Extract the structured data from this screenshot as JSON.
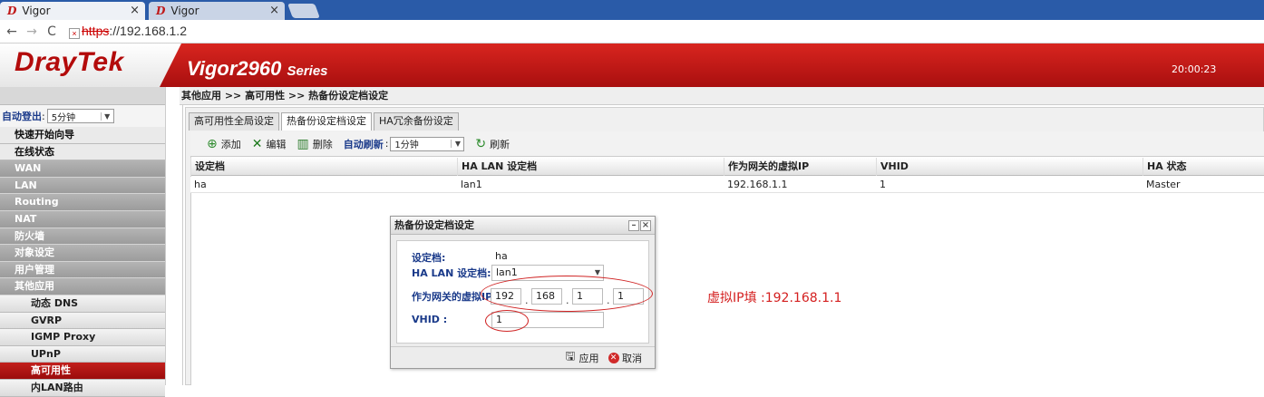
{
  "browser": {
    "tabs": [
      {
        "label": "Vigor"
      },
      {
        "label": "Vigor"
      }
    ],
    "url_proto": "https",
    "url_rest": "://192.168.1.2"
  },
  "banner": {
    "logo": "DrayTek",
    "model": "Vigor2960",
    "model_suffix": "Series",
    "clock": "20:00:23"
  },
  "sidebar": {
    "logout_label": "自动登出",
    "logout_value": "5分钟",
    "items": [
      {
        "label": "快速开始向导",
        "style": "light"
      },
      {
        "label": "在线状态",
        "style": "light"
      },
      {
        "label": "WAN",
        "style": "dark"
      },
      {
        "label": "LAN",
        "style": "dark"
      },
      {
        "label": "Routing",
        "style": "dark"
      },
      {
        "label": "NAT",
        "style": "dark"
      },
      {
        "label": "防火墙",
        "style": "dark"
      },
      {
        "label": "对象设定",
        "style": "dark"
      },
      {
        "label": "用户管理",
        "style": "dark"
      },
      {
        "label": "其他应用",
        "style": "dark"
      },
      {
        "label": "动态 DNS",
        "style": "sub"
      },
      {
        "label": "GVRP",
        "style": "sub"
      },
      {
        "label": "IGMP Proxy",
        "style": "sub"
      },
      {
        "label": "UPnP",
        "style": "sub"
      },
      {
        "label": "高可用性",
        "style": "active"
      },
      {
        "label": "内LAN路由",
        "style": "sub"
      }
    ]
  },
  "breadcrumb": "其他应用 >> 高可用性 >> 热备份设定档设定",
  "content_tabs": [
    {
      "label": "高可用性全局设定",
      "active": false
    },
    {
      "label": "热备份设定档设定",
      "active": true
    },
    {
      "label": "HA冗余备份设定",
      "active": false
    }
  ],
  "toolbar": {
    "add": "添加",
    "edit": "编辑",
    "delete": "删除",
    "auto_refresh_label": "自动刷新",
    "auto_refresh_value": "1分钟",
    "refresh": "刷新"
  },
  "table": {
    "columns": [
      "设定档",
      "HA LAN 设定档",
      "作为网关的虚拟IP",
      "VHID",
      "HA 状态"
    ],
    "rows": [
      [
        "ha",
        "lan1",
        "192.168.1.1",
        "1",
        "Master"
      ]
    ]
  },
  "dialog": {
    "title": "热备份设定档设定",
    "profile_label": "设定档",
    "profile_value": "ha",
    "lan_label": "HA LAN 设定档",
    "lan_value": "lan1",
    "vip_label": "作为网关的虚拟IP",
    "vip_octets": [
      "192",
      "168",
      "1",
      "1"
    ],
    "vhid_label": "VHID",
    "vhid_value": "1",
    "apply": "应用",
    "cancel": "取消"
  },
  "annotation": "虚拟IP填 :192.168.1.1",
  "colors": {
    "brand_red": "#c0191a",
    "annotation_red": "#d42020",
    "label_blue": "#1a3a8a"
  }
}
